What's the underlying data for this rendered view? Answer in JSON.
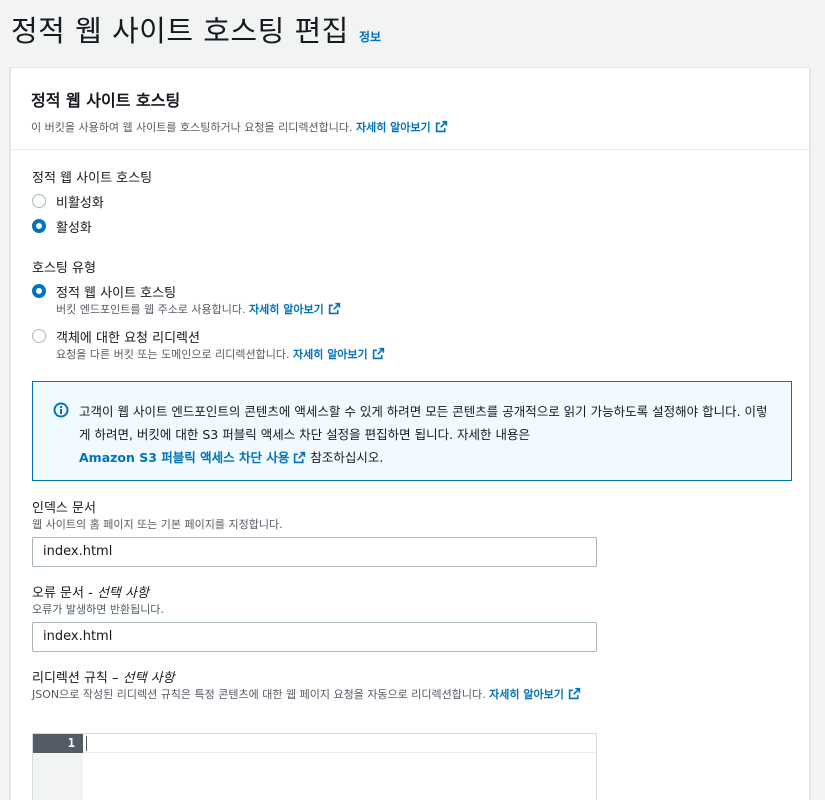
{
  "page": {
    "title": "정적 웹 사이트 호스팅 편집",
    "info_link": "정보"
  },
  "panel": {
    "title": "정적 웹 사이트 호스팅",
    "description": "이 버킷을 사용하여 웹 사이트를 호스팅하거나 요청을 리디렉션합니다.",
    "learn_more": "자세히 알아보기"
  },
  "hosting": {
    "label": "정적 웹 사이트 호스팅",
    "options": [
      {
        "label": "비활성화",
        "selected": false
      },
      {
        "label": "활성화",
        "selected": true
      }
    ]
  },
  "hosting_type": {
    "label": "호스팅 유형",
    "options": [
      {
        "label": "정적 웹 사이트 호스팅",
        "description": "버킷 엔드포인트를 웹 주소로 사용합니다.",
        "learn_more": "자세히 알아보기",
        "selected": true
      },
      {
        "label": "객체에 대한 요청 리디렉션",
        "description": "요청을 다른 버킷 또는 도메인으로 리디렉션합니다.",
        "learn_more": "자세히 알아보기",
        "selected": false
      }
    ]
  },
  "alert": {
    "text_part1": "고객이 웹 사이트 엔드포인트의 콘텐츠에 액세스할 수 있게 하려면 모든 콘텐츠를 공개적으로 읽기 가능하도록 설정해야 합니다. 이렇게 하려면, 버킷에 대한 S3 퍼블릭 액세스 차단 설정을 편집하면 됩니다. 자세한 내용은",
    "link": "Amazon S3 퍼블릭 액세스 차단 사용",
    "text_part2": "참조하십시오."
  },
  "index_document": {
    "label": "인덱스 문서",
    "description": "웹 사이트의 홈 페이지 또는 기본 페이지를 지정합니다.",
    "value": "index.html"
  },
  "error_document": {
    "label": "오류 문서 - ",
    "optional": "선택 사항",
    "description": "오류가 발생하면 반환됩니다.",
    "value": "index.html"
  },
  "redirection_rules": {
    "label": "리디렉션 규칙 – ",
    "optional": "선택 사항",
    "description": "JSON으로 작성된 리디렉션 규칙은 특정 콘텐츠에 대한 웹 페이지 요청을 자동으로 리디렉션합니다.",
    "learn_more": "자세히 알아보기",
    "line_number": "1"
  },
  "colors": {
    "accent": "#0073bb",
    "alert_bg": "#f1faff",
    "text": "#16191f",
    "muted": "#545b64"
  },
  "icons": [
    "external-link-icon",
    "info-circle-icon"
  ]
}
